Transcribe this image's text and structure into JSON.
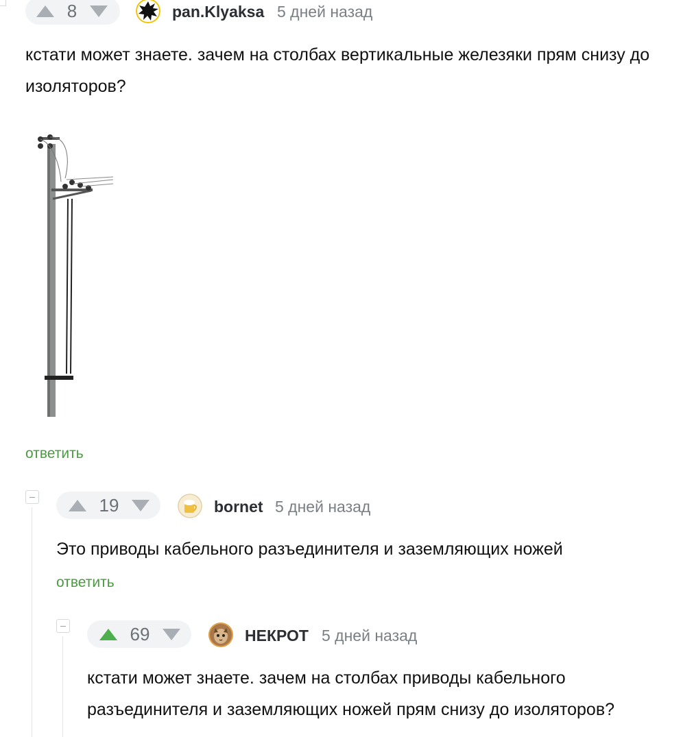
{
  "comments": [
    {
      "rating": "8",
      "author": "pan.Klyaksa",
      "time": "5 дней назад",
      "text": "кстати может знаете. зачем на столбах вертикальные железяки прям снизу до изоляторов?",
      "reply_label": "ответить",
      "avatar_icon": "ink-blot-avatar"
    },
    {
      "rating": "19",
      "author": "bornet",
      "time": "5 дней назад",
      "text": "Это приводы кабельного разъединителя и заземляющих ножей",
      "reply_label": "ответить",
      "avatar_icon": "beer-mug-avatar"
    },
    {
      "rating": "69",
      "upvoted": true,
      "author": "НЕКРОТ",
      "time": "5 дней назад",
      "text": "кстати может знаете. зачем на столбах приводы кабельного разъединителя и заземляющих ножей прям снизу до изоляторов?",
      "avatar_icon": "cat-face-avatar"
    }
  ],
  "colors": {
    "upvote_active": "#4cae4c",
    "reply_link": "#4a9a3f",
    "vote_bg": "#f2f3f5"
  }
}
